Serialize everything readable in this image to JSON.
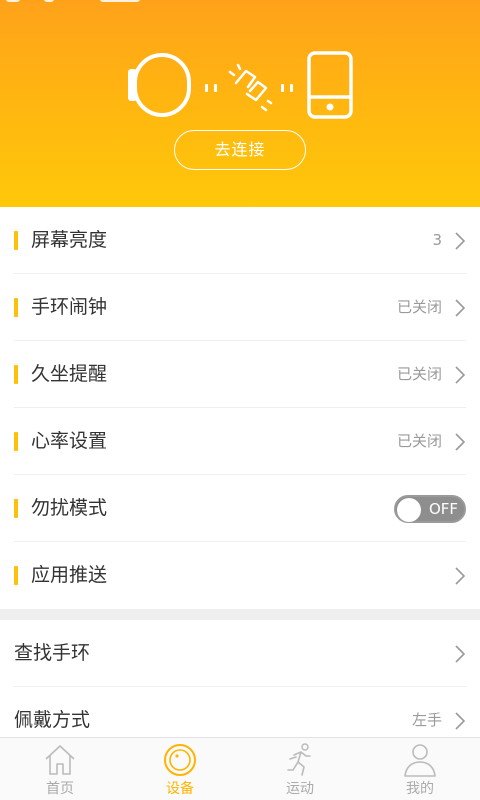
{
  "header": {
    "connect_button": "去连接"
  },
  "settings": [
    {
      "label": "屏幕亮度",
      "value": "3",
      "control": "chevron"
    },
    {
      "label": "手环闹钟",
      "value": "已关闭",
      "control": "chevron"
    },
    {
      "label": "久坐提醒",
      "value": "已关闭",
      "control": "chevron"
    },
    {
      "label": "心率设置",
      "value": "已关闭",
      "control": "chevron"
    },
    {
      "label": "勿扰模式",
      "control": "toggle",
      "toggle_text": "OFF"
    },
    {
      "label": "应用推送",
      "value": "",
      "control": "chevron"
    }
  ],
  "extra": [
    {
      "label": "查找手环",
      "value": ""
    },
    {
      "label": "佩戴方式",
      "value": "左手"
    }
  ],
  "nav": [
    {
      "label": "首页",
      "icon": "home-icon"
    },
    {
      "label": "设备",
      "icon": "device-icon",
      "active": true
    },
    {
      "label": "运动",
      "icon": "running-icon"
    },
    {
      "label": "我的",
      "icon": "profile-icon"
    }
  ],
  "colors": {
    "accent": "#FFC107",
    "header_top": "#FFA21A",
    "header_bottom": "#FFC80A",
    "active_nav": "#FFB400",
    "toggle_off": "#8E8E8E"
  }
}
